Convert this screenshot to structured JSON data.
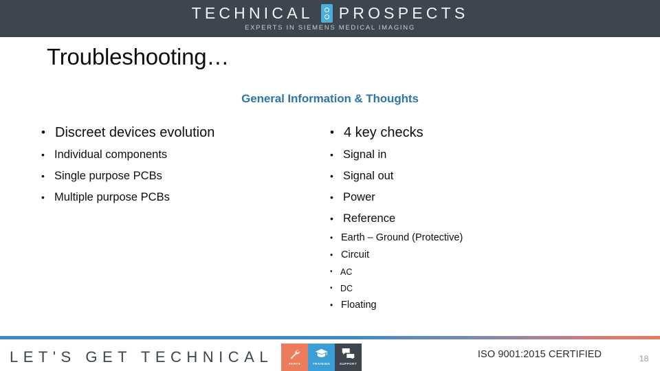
{
  "header": {
    "logo": {
      "word_left": "TECHNICAL",
      "word_right": "PROSPECTS",
      "mark_icon": "two-circles-icon",
      "tagline": "EXPERTS IN SIEMENS MEDICAL IMAGING",
      "background_color": "#3d454e",
      "mark_color": "#4aaede"
    }
  },
  "slide": {
    "title": "Troubleshooting…",
    "subtitle": "General Information & Thoughts",
    "subtitle_color": "#2e75a8",
    "left_column": {
      "heading": "Discreet devices evolution",
      "items": [
        "Individual components",
        "Single purpose PCBs",
        "Multiple purpose PCBs"
      ]
    },
    "right_column": {
      "heading": "4 key checks",
      "items": [
        "Signal in",
        "Signal out",
        "Power",
        "Reference"
      ],
      "reference_details": [
        "Earth – Ground (Protective)",
        "Circuit"
      ],
      "circuit_details": [
        "AC",
        "DC"
      ],
      "reference_tail": [
        "Floating"
      ]
    }
  },
  "footer": {
    "tagline": "LET'S GET TECHNICAL",
    "tiles": [
      {
        "label": "PARTS",
        "icon": "wrench-icon",
        "color": "#ed7c5e"
      },
      {
        "label": "TRAINING",
        "icon": "graduation-cap-icon",
        "color": "#3b9ed4"
      },
      {
        "label": "SUPPORT",
        "icon": "speech-bubbles-icon",
        "color": "#3d454e"
      }
    ],
    "iso": "ISO 9001:2015 CERTIFIED",
    "page_number": "18",
    "rule_gradient_start": "#3b8bbf",
    "rule_gradient_end": "#e8795a"
  }
}
